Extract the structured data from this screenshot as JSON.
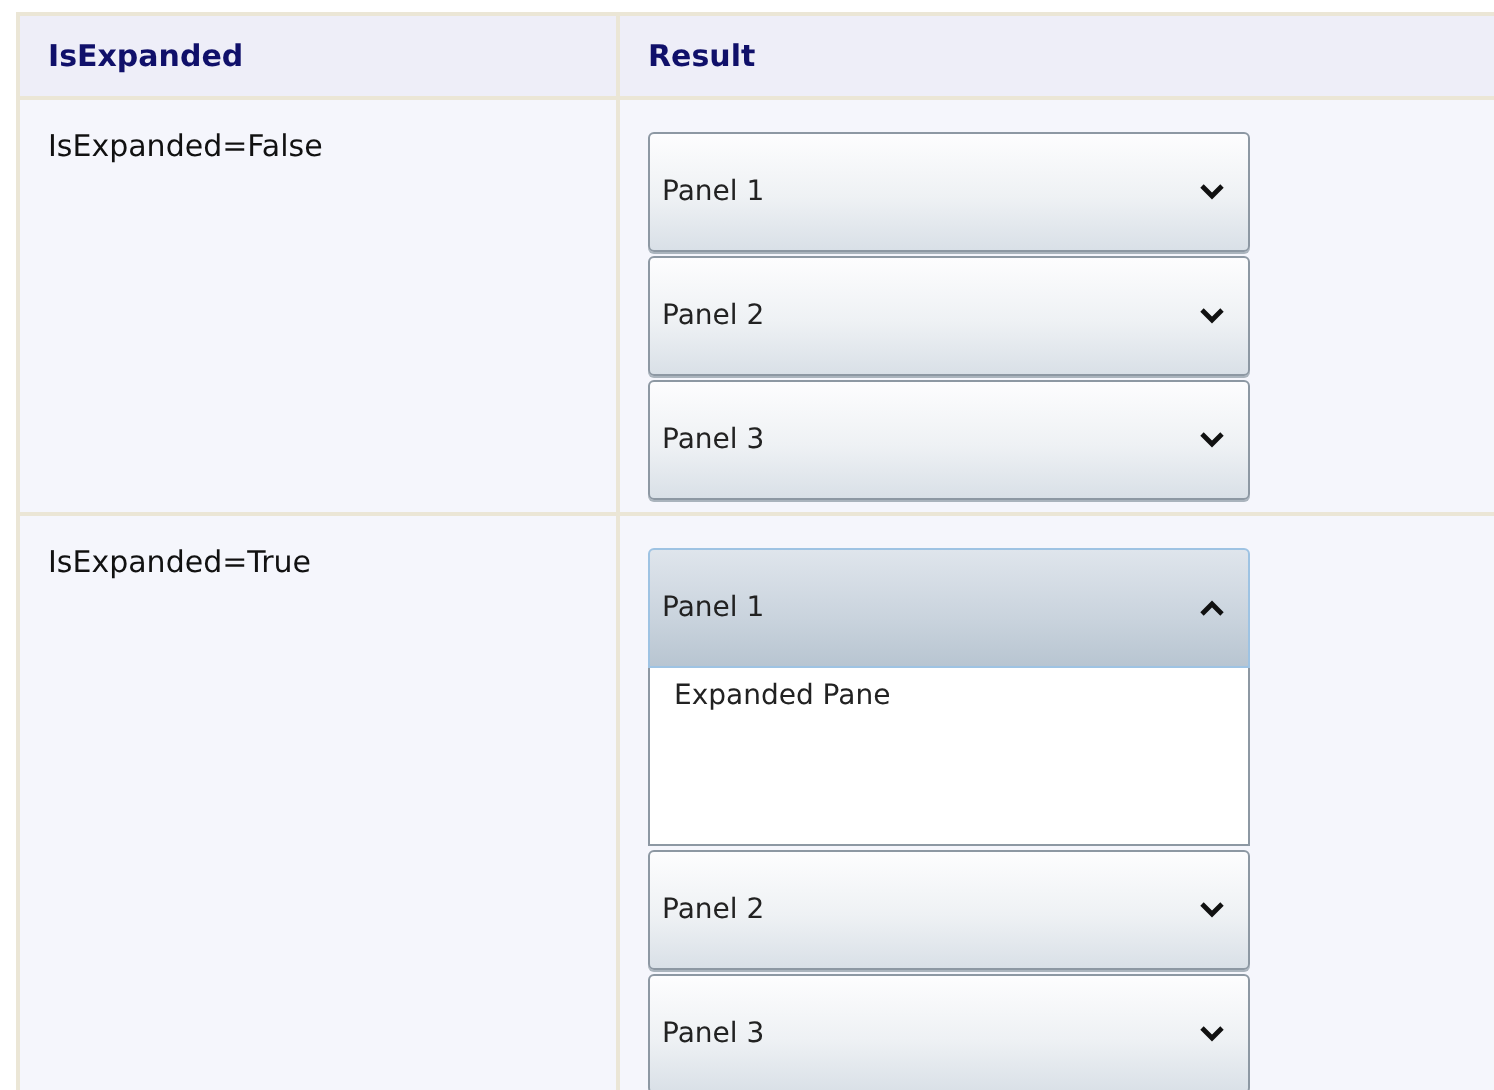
{
  "table": {
    "columns": [
      "IsExpanded",
      "Result"
    ],
    "rows": [
      {
        "label": "IsExpanded=False",
        "panels": [
          {
            "title": "Panel 1",
            "expanded": false
          },
          {
            "title": "Panel 2",
            "expanded": false
          },
          {
            "title": "Panel 3",
            "expanded": false
          }
        ]
      },
      {
        "label": "IsExpanded=True",
        "panels": [
          {
            "title": "Panel 1",
            "expanded": true,
            "content": "Expanded Pane"
          },
          {
            "title": "Panel 2",
            "expanded": false
          },
          {
            "title": "Panel 3",
            "expanded": false
          }
        ]
      }
    ]
  }
}
